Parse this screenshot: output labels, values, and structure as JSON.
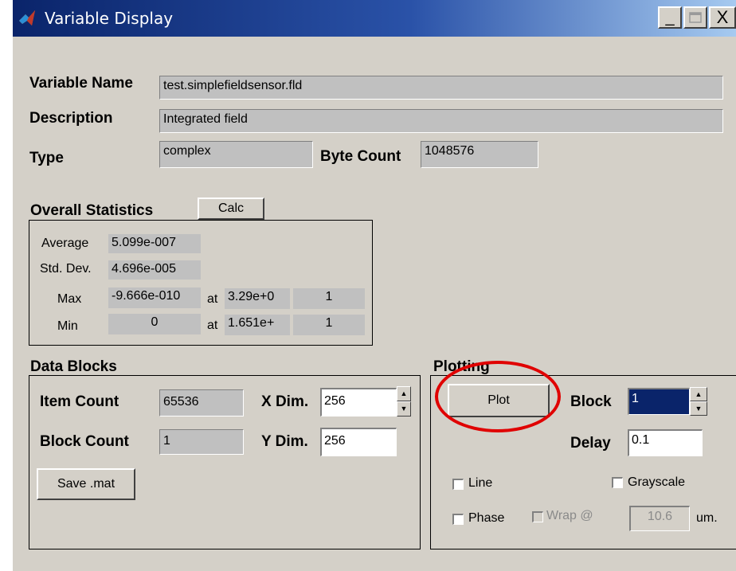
{
  "window": {
    "title": "Variable Display",
    "minimize": "_",
    "close": "X"
  },
  "fields": {
    "variable_name_label": "Variable Name",
    "variable_name": "test.simplefieldsensor.fld",
    "description_label": "Description",
    "description": "Integrated field",
    "type_label": "Type",
    "type": "complex",
    "byte_count_label": "Byte Count",
    "byte_count": "1048576"
  },
  "stats": {
    "title": "Overall Statistics",
    "calc_label": "Calc",
    "average_label": "Average",
    "average": "5.099e-007",
    "std_label": "Std. Dev.",
    "std": "4.696e-005",
    "max_label": "Max",
    "max": "-9.666e-010",
    "max_at_label": "at",
    "max_at": "3.29e+0",
    "max_idx": "1",
    "min_label": "Min",
    "min": "0",
    "min_at_label": "at",
    "min_at": "1.651e+",
    "min_idx": "1"
  },
  "data_blocks": {
    "title": "Data Blocks",
    "item_count_label": "Item Count",
    "item_count": "65536",
    "block_count_label": "Block Count",
    "block_count": "1",
    "xdim_label": "X Dim.",
    "xdim": "256",
    "ydim_label": "Y Dim.",
    "ydim": "256",
    "save_label": "Save .mat"
  },
  "plotting": {
    "title": "Plotting",
    "plot_label": "Plot",
    "block_label": "Block",
    "block_value": "1",
    "delay_label": "Delay",
    "delay_value": "0.1",
    "line_label": "Line",
    "grayscale_label": "Grayscale",
    "phase_label": "Phase",
    "wrap_label": "Wrap @",
    "wrap_value": "10.6",
    "wrap_unit": "um."
  },
  "colors": {
    "titlebar_start": "#0a246a",
    "window_bg": "#d4d0c8",
    "annotation": "#e00000",
    "block_selection": "#0a246a"
  }
}
